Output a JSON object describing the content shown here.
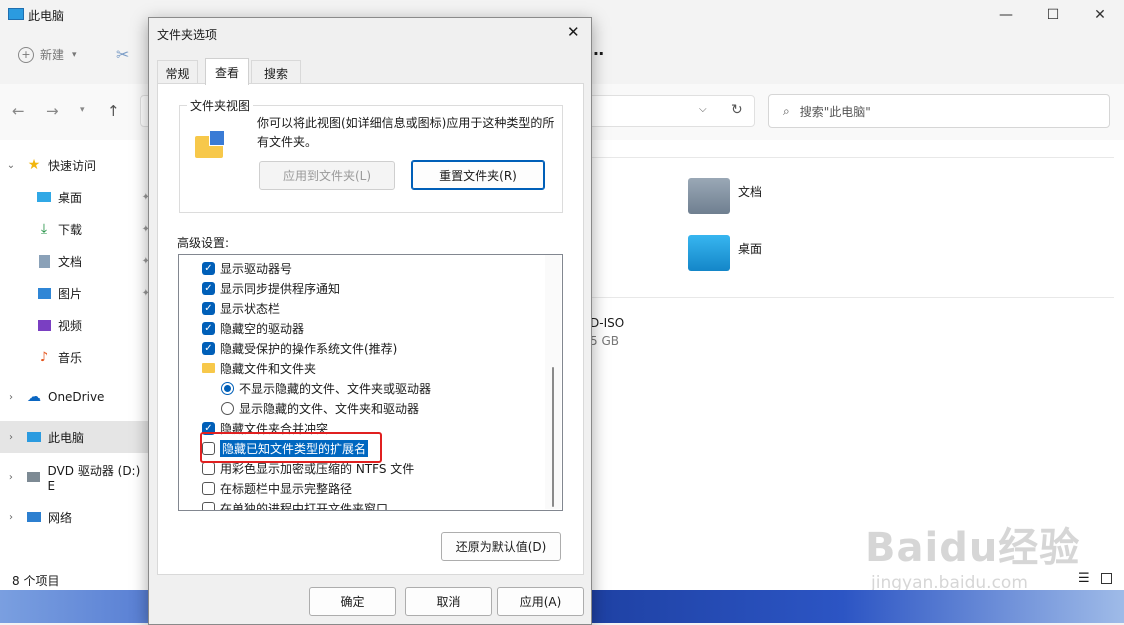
{
  "explorer": {
    "title": "此电脑",
    "toolbar": {
      "new_label": "新建"
    },
    "search": {
      "placeholder": "搜索\"此电脑\""
    },
    "nav": {
      "quick_access": "快速访问",
      "desktop": "桌面",
      "downloads": "下载",
      "documents": "文档",
      "pictures": "图片",
      "videos": "视频",
      "music": "音乐",
      "onedrive": "OneDrive",
      "this_pc": "此电脑",
      "dvd": "DVD 驱动器 (D:) E",
      "network": "网络"
    },
    "content": {
      "folder_documents": "文档",
      "folder_desktop": "桌面",
      "drive_name_partial": "D-ISO",
      "drive_size_partial": "5 GB"
    },
    "status": {
      "item_count": "8 个项目"
    }
  },
  "dialog": {
    "title": "文件夹选项",
    "tabs": [
      "常规",
      "查看",
      "搜索"
    ],
    "folder_views": {
      "legend": "文件夹视图",
      "description": "你可以将此视图(如详细信息或图标)应用于这种类型的所有文件夹。",
      "apply_button": "应用到文件夹(L)",
      "reset_button": "重置文件夹(R)"
    },
    "advanced_label": "高级设置:",
    "advanced_items": [
      {
        "label": "显示驱动器号",
        "kind": "check",
        "checked": true
      },
      {
        "label": "显示同步提供程序通知",
        "kind": "check",
        "checked": true
      },
      {
        "label": "显示状态栏",
        "kind": "check",
        "checked": true
      },
      {
        "label": "隐藏空的驱动器",
        "kind": "check",
        "checked": true
      },
      {
        "label": "隐藏受保护的操作系统文件(推荐)",
        "kind": "check",
        "checked": true
      },
      {
        "label": "隐藏文件和文件夹",
        "kind": "folder"
      },
      {
        "label": "不显示隐藏的文件、文件夹或驱动器",
        "kind": "radio",
        "checked": true
      },
      {
        "label": "显示隐藏的文件、文件夹和驱动器",
        "kind": "radio",
        "checked": false
      },
      {
        "label": "隐藏文件夹合并冲突",
        "kind": "check",
        "checked": true
      },
      {
        "label": "隐藏已知文件类型的扩展名",
        "kind": "check",
        "checked": false,
        "selected": true
      },
      {
        "label": "用彩色显示加密或压缩的 NTFS 文件",
        "kind": "check",
        "checked": false
      },
      {
        "label": "在标题栏中显示完整路径",
        "kind": "check",
        "checked": false
      },
      {
        "label": "在单独的进程中打开文件夹窗口",
        "kind": "check",
        "checked": false
      }
    ],
    "restore_defaults": "还原为默认值(D)",
    "ok": "确定",
    "cancel": "取消",
    "apply": "应用(A)"
  },
  "watermark": {
    "brand": "Baidu经验",
    "url": "jingyan.baidu.com"
  },
  "colors": {
    "accent": "#005fb8",
    "highlight_red": "#e02020",
    "selection": "#0067c0"
  }
}
